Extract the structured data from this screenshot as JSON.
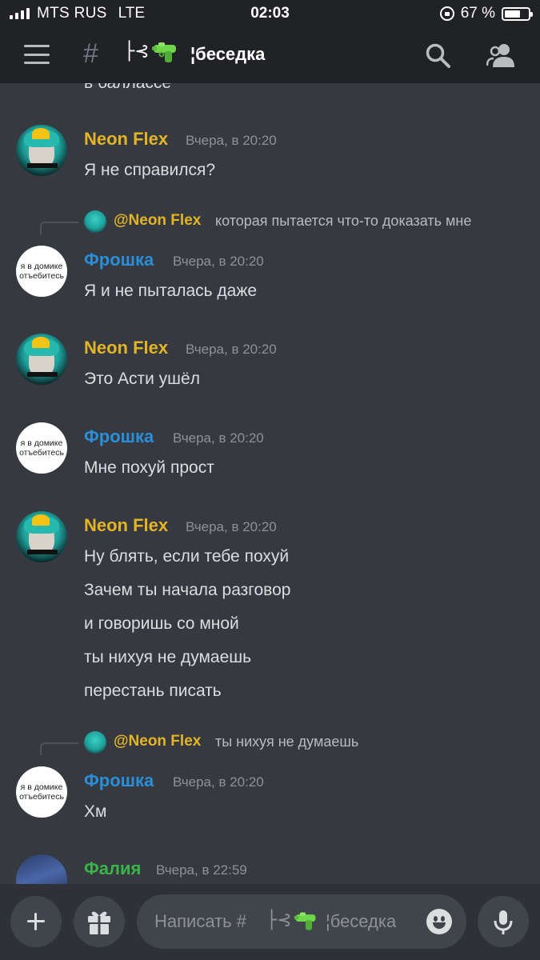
{
  "status_bar": {
    "carrier": "MTS RUS",
    "network": "LTE",
    "time": "02:03",
    "battery": "67 %",
    "battery_level": 0.67
  },
  "header": {
    "menu_icon": "hamburger-menu-icon",
    "channel_hash": "#",
    "channel_prefix": "├⊰",
    "channel_emoji": "water-pistol-icon",
    "channel_name": "¦беседка",
    "search_icon": "search-icon",
    "members_icon": "members-icon"
  },
  "messages": {
    "cut_text": "в баллассе",
    "m1": {
      "author": "Neon Flex",
      "time": "Вчера, в 20:20",
      "lines": [
        "Я не справился?"
      ]
    },
    "r1": {
      "mention": "@Neon Flex",
      "text": "которая пытается что-то доказать мне"
    },
    "m2": {
      "author": "Фрошка",
      "avatar_text": [
        "я в домике",
        "отъебитесь"
      ],
      "time": "Вчера, в 20:20",
      "lines": [
        "Я и не пыталась даже"
      ]
    },
    "m3": {
      "author": "Neon Flex",
      "time": "Вчера, в 20:20",
      "lines": [
        "Это Асти ушёл"
      ]
    },
    "m4": {
      "author": "Фрошка",
      "avatar_text": [
        "я в домике",
        "отъебитесь"
      ],
      "time": "Вчера, в 20:20",
      "lines": [
        "Мне похуй прост"
      ]
    },
    "m5": {
      "author": "Neon Flex",
      "time": "Вчера, в 20:20",
      "lines": [
        "Ну блять, если тебе похуй",
        "Зачем ты начала разговор",
        "и говоришь со мной",
        "ты нихуя не думаешь",
        "перестань писать"
      ]
    },
    "r2": {
      "mention": "@Neon Flex",
      "text": "ты нихуя не думаешь"
    },
    "m6": {
      "author": "Фрошка",
      "avatar_text": [
        "я в домике",
        "отъебитесь"
      ],
      "time": "Вчера, в 20:20",
      "lines": [
        "Хм"
      ]
    },
    "m7": {
      "author": "Фалия",
      "time": "Вчера, в 22:59"
    }
  },
  "composer": {
    "placeholder_start": "Написать #",
    "placeholder_prefix": "├⊰",
    "placeholder_end": "¦беседка",
    "plus_icon": "plus-icon",
    "gift_icon": "gift-icon",
    "emoji_icon": "emoji-icon",
    "mic_icon": "microphone-icon"
  },
  "colors": {
    "background": "#36393f",
    "header": "#202225",
    "neon_flex": "#e3b526",
    "froshka": "#2a8fd8",
    "falia": "#3bb54a",
    "timestamp": "#8e9297"
  }
}
